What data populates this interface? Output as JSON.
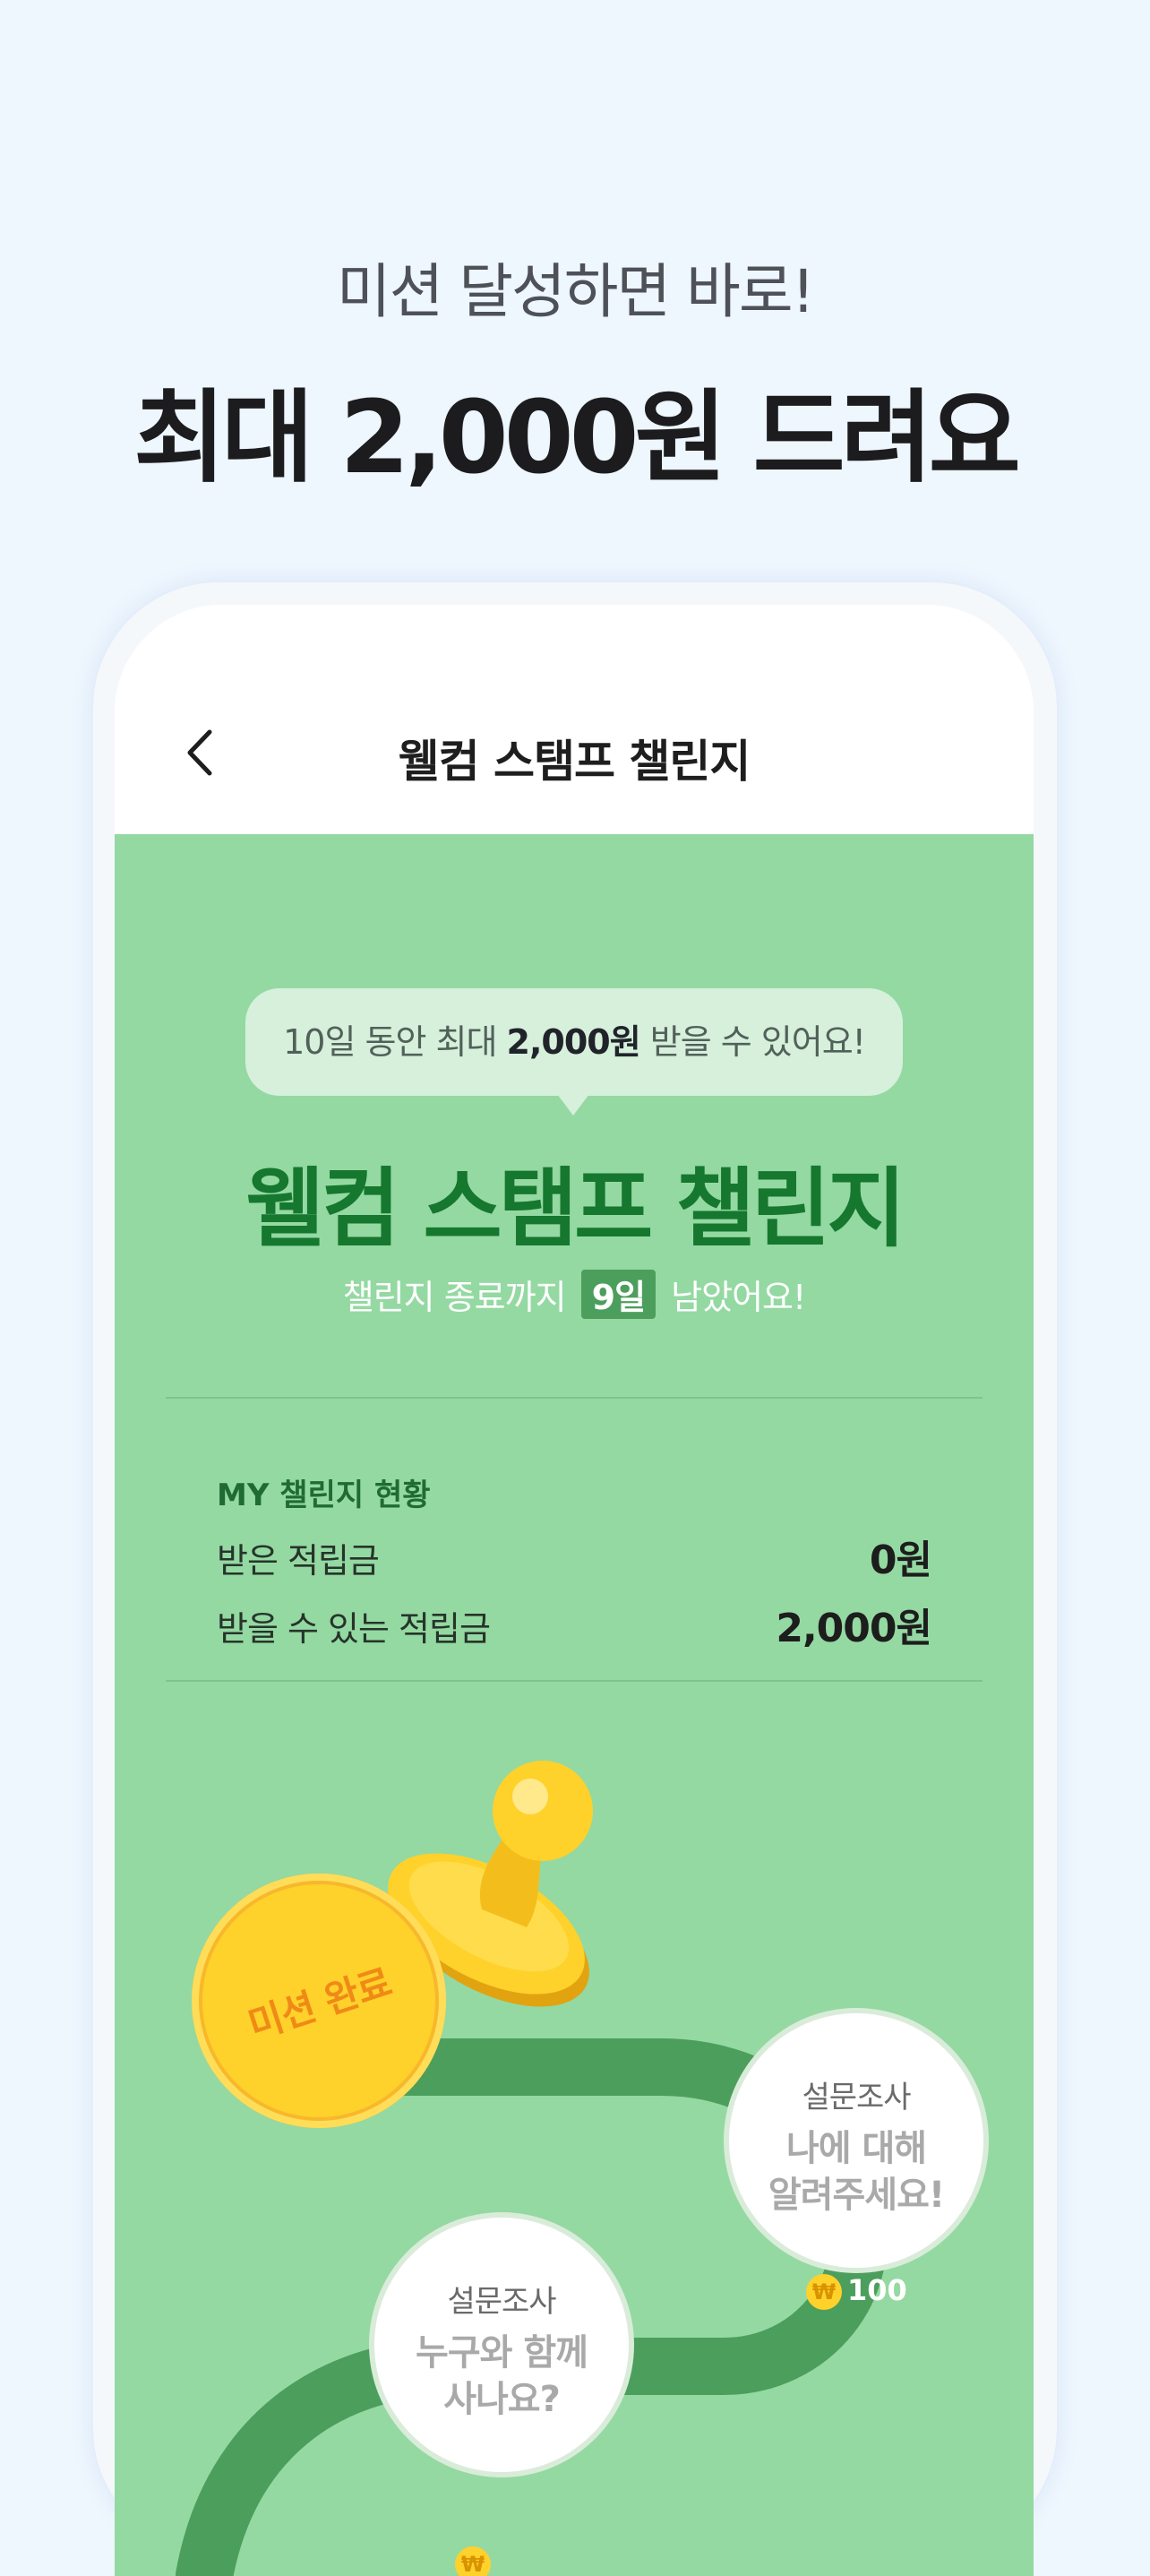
{
  "promo": {
    "subtitle": "미션 달성하면 바로!",
    "title": "최대 2,000원 드려요"
  },
  "nav": {
    "back_icon": "chevron-left-icon",
    "title": "웰컴 스탬프 챌린지"
  },
  "hero": {
    "bubble_prefix": "10일 동안 최대 ",
    "bubble_amount": "2,000원",
    "bubble_suffix": " 받을 수 있어요!",
    "title": "웰컴 스탬프 챌린지",
    "remaining_prefix": "챌린지 종료까지",
    "remaining_days": "9일",
    "remaining_suffix": "남았어요!"
  },
  "status": {
    "title": "MY 챌린지 현황",
    "received_label": "받은 적립금",
    "received_value": "0원",
    "available_label": "받을 수 있는 적립금",
    "available_value": "2,000원"
  },
  "missions": [
    {
      "state": "완료",
      "label": "미션 완료"
    },
    {
      "category": "설문조사",
      "title": "나에 대해\n알려주세요!",
      "reward": "100"
    },
    {
      "category": "설문조사",
      "title": "누구와 함께\n사나요?",
      "reward": ""
    }
  ],
  "colors": {
    "background": "#eef6fe",
    "content_green": "#94d9a2",
    "path_green": "#4c9e5c",
    "title_green": "#16772f",
    "gold": "#ffd12b"
  }
}
